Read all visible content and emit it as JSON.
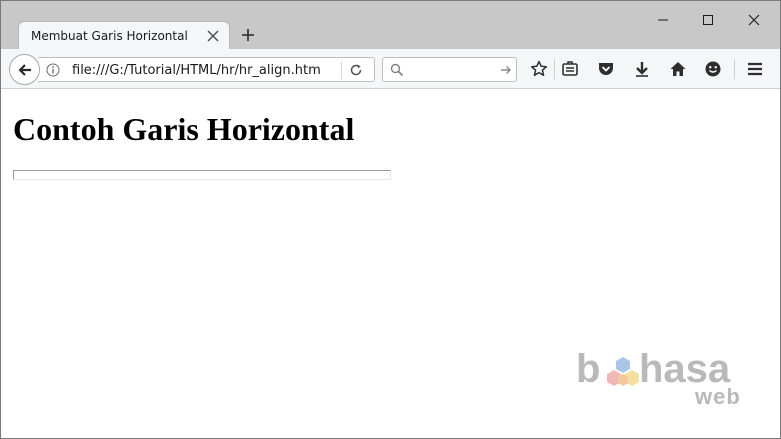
{
  "browser": {
    "tab_title": "Membuat Garis Horizontal",
    "url": "file:///G:/Tutorial/HTML/hr/hr_align.htm",
    "search_placeholder": ""
  },
  "page": {
    "heading": "Contoh Garis Horizontal"
  },
  "watermark": {
    "part1": "b",
    "part2": "hasa",
    "part3": "web",
    "hex_colors": [
      "#a9c5e8",
      "#f2b8b8",
      "#f5dfa0",
      "#f3c89a"
    ]
  },
  "icons": [
    "tab-close-icon",
    "new-tab-icon",
    "minimize-icon",
    "maximize-icon",
    "window-close-icon",
    "back-arrow-icon",
    "info-icon",
    "reload-icon",
    "search-icon",
    "search-go-arrow-icon",
    "bookmark-star-icon",
    "reading-list-icon",
    "pocket-icon",
    "download-icon",
    "home-icon",
    "smiley-feedback-icon",
    "hamburger-menu-icon"
  ]
}
